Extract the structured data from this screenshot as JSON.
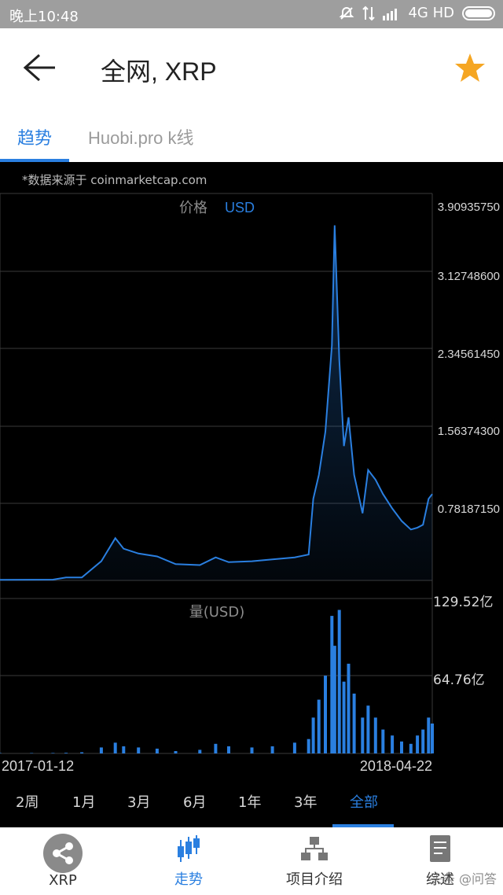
{
  "status_bar": {
    "time": "晚上10:48",
    "network": "4G HD"
  },
  "header": {
    "title": "全网, XRP",
    "star_color": "#f5a623"
  },
  "tabs": [
    {
      "label": "趋势",
      "active": true
    },
    {
      "label": "Huobi.pro k线",
      "active": false
    }
  ],
  "chart": {
    "source": "*数据来源于 coinmarketcap.com",
    "price_label": "价格",
    "currency": "USD",
    "volume_label": "量(USD)",
    "price_ticks": [
      "3.90935750",
      "3.12748600",
      "2.34561450",
      "1.56374300",
      "0.78187150"
    ],
    "volume_ticks": [
      "129.52亿",
      "64.76亿"
    ],
    "start_date": "2017-01-12",
    "end_date": "2018-04-22",
    "accent_color": "#2a7fe0"
  },
  "chart_data": {
    "type": "line",
    "title": "",
    "xlabel": "",
    "ylabel": "价格 USD",
    "ylim": [
      0,
      3.9093575
    ],
    "grid": true,
    "x": [
      "2017-01-12",
      "2017-02-15",
      "2017-03-10",
      "2017-03-24",
      "2017-04-10",
      "2017-05-01",
      "2017-05-16",
      "2017-05-25",
      "2017-06-10",
      "2017-06-30",
      "2017-07-20",
      "2017-08-15",
      "2017-09-01",
      "2017-09-15",
      "2017-10-10",
      "2017-11-01",
      "2017-11-25",
      "2017-12-10",
      "2017-12-15",
      "2017-12-21",
      "2017-12-28",
      "2018-01-04",
      "2018-01-07",
      "2018-01-12",
      "2018-01-17",
      "2018-01-22",
      "2018-01-28",
      "2018-02-06",
      "2018-02-12",
      "2018-02-20",
      "2018-02-28",
      "2018-03-10",
      "2018-03-20",
      "2018-03-30",
      "2018-04-06",
      "2018-04-12",
      "2018-04-18",
      "2018-04-22"
    ],
    "series": [
      {
        "values": [
          0.006,
          0.007,
          0.008,
          0.03,
          0.03,
          0.2,
          0.44,
          0.33,
          0.28,
          0.25,
          0.17,
          0.16,
          0.24,
          0.19,
          0.2,
          0.22,
          0.24,
          0.27,
          0.85,
          1.1,
          1.55,
          2.45,
          3.7,
          2.3,
          1.4,
          1.7,
          1.1,
          0.7,
          1.15,
          1.05,
          0.9,
          0.75,
          0.62,
          0.53,
          0.55,
          0.58,
          0.85,
          0.9
        ]
      },
      {
        "values": [
          0.03,
          0.03,
          0.04,
          0.05,
          0.1,
          0.5,
          0.9,
          0.6,
          0.5,
          0.4,
          0.2,
          0.3,
          0.8,
          0.6,
          0.5,
          0.6,
          0.9,
          1.2,
          3.0,
          4.5,
          6.5,
          11.5,
          9.0,
          12.0,
          6.0,
          7.5,
          5.0,
          3.0,
          4.0,
          3.0,
          2.0,
          1.5,
          1.0,
          0.8,
          1.5,
          2.0,
          3.0,
          2.5
        ]
      }
    ]
  },
  "ranges": [
    "2周",
    "1月",
    "3月",
    "6月",
    "1年",
    "3年",
    "全部"
  ],
  "active_range": "全部",
  "bottom_nav": [
    {
      "label": "XRP",
      "icon": "ripple-logo-icon"
    },
    {
      "label": "走势",
      "icon": "candlestick-icon",
      "active": true
    },
    {
      "label": "项目介绍",
      "icon": "org-chart-icon"
    },
    {
      "label": "综述",
      "icon": "document-icon"
    }
  ],
  "watermark": "头条 @问答"
}
